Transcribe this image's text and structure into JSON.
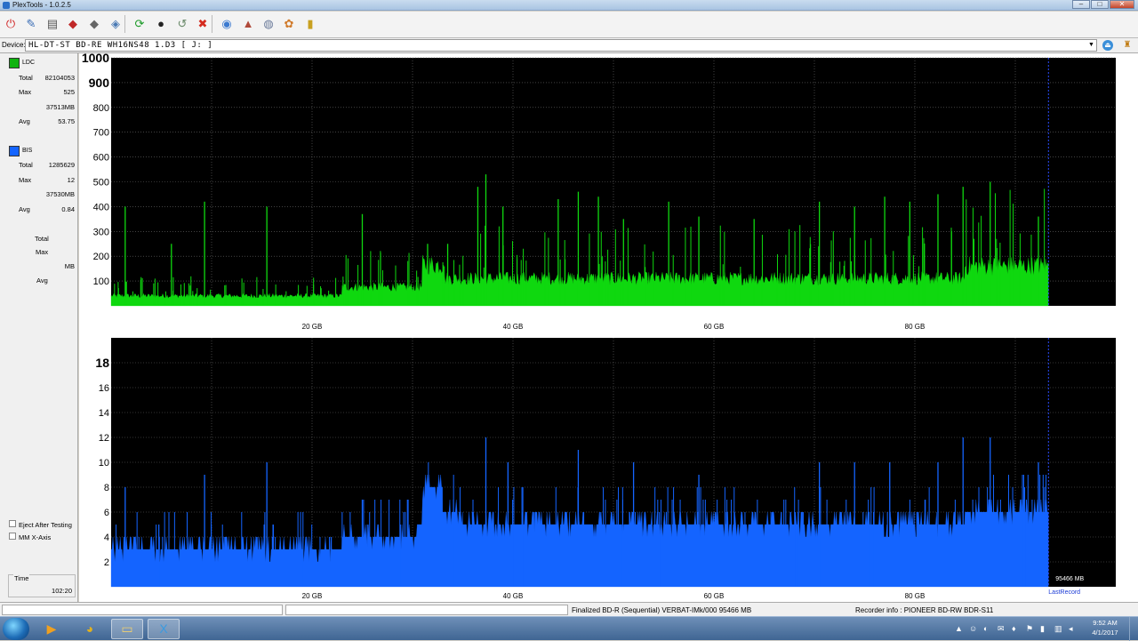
{
  "window": {
    "title": "PlexTools - 1.0.2.5",
    "minimize": "–",
    "maximize": "□",
    "close": "✕"
  },
  "toolbar": {
    "icons": [
      {
        "name": "power-icon",
        "glyph": "⏻",
        "color": "#d02020"
      },
      {
        "name": "wizard-icon",
        "glyph": "✎",
        "color": "#3a6db5"
      },
      {
        "name": "drive-info-icon",
        "glyph": "▤",
        "color": "#555"
      },
      {
        "name": "write-icon",
        "glyph": "◆",
        "color": "#c02828"
      },
      {
        "name": "read-icon",
        "glyph": "◆",
        "color": "#666"
      },
      {
        "name": "copy-icon",
        "glyph": "◈",
        "color": "#4a7ab5"
      },
      {
        "name": "refresh-icon",
        "glyph": "⟳",
        "color": "#1e9b2a"
      },
      {
        "name": "disc-icon",
        "glyph": "●",
        "color": "#222"
      },
      {
        "name": "erase-icon",
        "glyph": "↺",
        "color": "#6a8a6a"
      },
      {
        "name": "stop-icon",
        "glyph": "✖",
        "color": "#d42a1e"
      },
      {
        "name": "scan-icon",
        "glyph": "◉",
        "color": "#3c7ad0"
      },
      {
        "name": "report-icon",
        "glyph": "▲",
        "color": "#b04a3a"
      },
      {
        "name": "settings-icon",
        "glyph": "◍",
        "color": "#6a7a9a"
      },
      {
        "name": "globe-icon",
        "glyph": "✿",
        "color": "#d07a2a"
      },
      {
        "name": "help-icon",
        "glyph": "▮",
        "color": "#c8a020"
      }
    ]
  },
  "device": {
    "label": "Device:",
    "value": "HL-DT-ST BD-RE  WH16NS48  1.D3 [ J: ]"
  },
  "left_panel": {
    "ldc": {
      "label": "LDC",
      "color": "#0fb30f",
      "stats": [
        {
          "k": "Total",
          "v": "82104053"
        },
        {
          "k": "Max",
          "v": "525"
        },
        {
          "k": "",
          "v": "37513MB"
        },
        {
          "k": "Avg",
          "v": "53.75"
        }
      ]
    },
    "bis": {
      "label": "BIS",
      "color": "#1464ff",
      "stats": [
        {
          "k": "Total",
          "v": "1285629"
        },
        {
          "k": "Max",
          "v": "12"
        },
        {
          "k": "",
          "v": "37530MB"
        },
        {
          "k": "Avg",
          "v": "0.84"
        }
      ]
    },
    "third": {
      "total": "Total",
      "max": "Max",
      "mb": "MB",
      "avg": "Avg"
    },
    "eject_after_testing": "Eject After Testing",
    "mm_x_axis": "MM X-Axis",
    "time_label": "Time",
    "time_value": "102:20"
  },
  "chart_data": [
    {
      "type": "area",
      "series": [
        {
          "name": "LDC",
          "color": "#0fd80f"
        }
      ],
      "x_unit": "GB",
      "xlim": [
        0,
        100
      ],
      "x_ticks": [
        "20 GB",
        "40 GB",
        "60 GB",
        "80 GB"
      ],
      "ylim": [
        0,
        1000
      ],
      "y_ticks": [
        "1000",
        "900",
        "800",
        "700",
        "600",
        "500",
        "400",
        "300",
        "200",
        "100"
      ],
      "baseline_segments": [
        {
          "x": [
            0,
            23
          ],
          "y": 40
        },
        {
          "x": [
            23,
            31
          ],
          "y": 75
        },
        {
          "x": [
            31,
            33
          ],
          "y": 165
        },
        {
          "x": [
            33,
            85
          ],
          "y": 110
        },
        {
          "x": [
            85,
            93.3
          ],
          "y": 160
        }
      ],
      "spikes": [
        {
          "x": 1.4,
          "y": 400
        },
        {
          "x": 6,
          "y": 250
        },
        {
          "x": 9.3,
          "y": 420
        },
        {
          "x": 15.5,
          "y": 400
        },
        {
          "x": 25,
          "y": 370
        },
        {
          "x": 31.5,
          "y": 250
        },
        {
          "x": 33.5,
          "y": 250
        },
        {
          "x": 36.5,
          "y": 480
        },
        {
          "x": 37.3,
          "y": 530
        },
        {
          "x": 39,
          "y": 400
        },
        {
          "x": 44.5,
          "y": 430
        },
        {
          "x": 46.5,
          "y": 460
        },
        {
          "x": 48.5,
          "y": 440
        },
        {
          "x": 51,
          "y": 350
        },
        {
          "x": 55.5,
          "y": 420
        },
        {
          "x": 58.5,
          "y": 360
        },
        {
          "x": 64,
          "y": 350
        },
        {
          "x": 70.5,
          "y": 420
        },
        {
          "x": 74,
          "y": 400
        },
        {
          "x": 77,
          "y": 440
        },
        {
          "x": 79.5,
          "y": 420
        },
        {
          "x": 82.3,
          "y": 450
        },
        {
          "x": 84.8,
          "y": 480
        },
        {
          "x": 87.5,
          "y": 500
        },
        {
          "x": 92.3,
          "y": 360
        }
      ],
      "end_marker_x": 93.3
    },
    {
      "type": "bar",
      "series": [
        {
          "name": "BIS",
          "color": "#1464ff"
        }
      ],
      "x_unit": "GB",
      "xlim": [
        0,
        100
      ],
      "x_ticks": [
        "20 GB",
        "40 GB",
        "60 GB",
        "80 GB"
      ],
      "ylim": [
        0,
        20
      ],
      "y_ticks": [
        "18",
        "16",
        "14",
        "12",
        "10",
        "8",
        "6",
        "4",
        "2"
      ],
      "baseline_segments": [
        {
          "x": [
            0,
            23
          ],
          "y": 3
        },
        {
          "x": [
            23,
            31
          ],
          "y": 4
        },
        {
          "x": [
            31,
            33
          ],
          "y": 8
        },
        {
          "x": [
            33,
            35
          ],
          "y": 6
        },
        {
          "x": [
            35,
            85
          ],
          "y": 5
        },
        {
          "x": [
            85,
            93.3
          ],
          "y": 6
        }
      ],
      "spikes": [
        {
          "x": 1.4,
          "y": 8
        },
        {
          "x": 9.3,
          "y": 9
        },
        {
          "x": 15.5,
          "y": 10
        },
        {
          "x": 25,
          "y": 7
        },
        {
          "x": 31.5,
          "y": 8
        },
        {
          "x": 37.3,
          "y": 12
        },
        {
          "x": 39.5,
          "y": 10
        },
        {
          "x": 46.5,
          "y": 11
        },
        {
          "x": 52,
          "y": 10
        },
        {
          "x": 58.5,
          "y": 9
        },
        {
          "x": 70.5,
          "y": 10
        },
        {
          "x": 74,
          "y": 10
        },
        {
          "x": 77.5,
          "y": 10
        },
        {
          "x": 82.3,
          "y": 10
        },
        {
          "x": 84.8,
          "y": 12
        },
        {
          "x": 87.5,
          "y": 12
        },
        {
          "x": 92.3,
          "y": 10
        }
      ],
      "end_marker_x": 93.3,
      "end_label": "95466 MB",
      "last_record": "LastRecord"
    }
  ],
  "status": {
    "disc": "Finalized   BD-R (Sequential)   VERBAT-IMk/000   95466 MB",
    "recorder": "Recorder info : PIONEER      BD-RW   BDR-S11"
  },
  "taskbar": {
    "apps": [
      {
        "name": "media-player-icon",
        "glyph": "▶",
        "color": "#f0a020"
      },
      {
        "name": "chrome-icon",
        "glyph": "◕",
        "color": "#e0b020"
      },
      {
        "name": "explorer-icon",
        "glyph": "▭",
        "color": "#f0d070"
      },
      {
        "name": "plextools-icon",
        "glyph": "X",
        "color": "#3a9ae0"
      }
    ],
    "time": "9:52 AM",
    "date": "4/1/2017"
  }
}
